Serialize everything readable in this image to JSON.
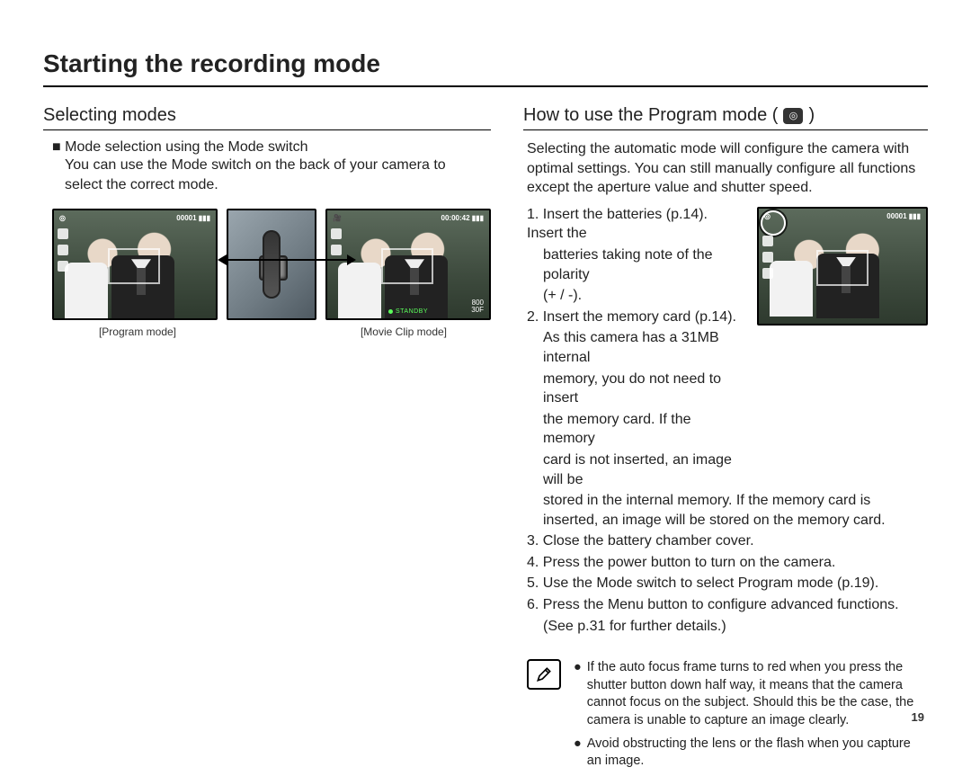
{
  "page": {
    "title": "Starting the recording mode",
    "number": "19"
  },
  "left": {
    "heading": "Selecting modes",
    "bullet": "Mode selection using the Mode switch",
    "bulletText": "You can use the Mode switch on the back of your camera to select the correct mode.",
    "caption1": "[Program mode]",
    "caption2": "[Movie Clip mode]",
    "lcd": {
      "topLeftIcon": "◎",
      "imageCount": "00001",
      "batteryIcon": "▮▮▮",
      "movieTopIcon": "🎥",
      "movieTime": "00:00:42",
      "resolution": "800",
      "fps": "30F",
      "standby": "STANDBY"
    }
  },
  "right": {
    "heading_before": "How to use the Program mode (",
    "heading_after": ")",
    "modeIconGlyph": "◎",
    "intro": "Selecting the automatic mode will configure the camera with optimal settings. You can still manually configure all functions except the aperture value and shutter speed.",
    "steps": {
      "s1a": "1. Insert the batteries (p.14). Insert the",
      "s1b": "batteries taking note of the polarity",
      "s1c": "(+ / -).",
      "s2a": "2. Insert the memory card (p.14).",
      "s2b": "As this camera has a 31MB internal",
      "s2c": "memory, you do not need to insert",
      "s2d": "the memory card. If the memory",
      "s2e": "card is not inserted, an image will be",
      "s2f": "stored in the internal memory. If the memory card is inserted, an image will be stored on the memory card.",
      "s3": "3. Close the battery chamber cover.",
      "s4": "4. Press the power button to turn on the camera.",
      "s5": "5. Use the Mode switch to select Program mode (p.19).",
      "s6a": "6. Press the Menu button to configure advanced functions.",
      "s6b": "(See p.31 for further details.)"
    },
    "notes": {
      "n1": "If the auto focus frame turns to red when you press the shutter button down half way, it means that the camera cannot focus on the subject. Should this be the case, the camera is unable to capture an image clearly.",
      "n2": "Avoid obstructing the lens or the flash when you capture an image."
    }
  }
}
